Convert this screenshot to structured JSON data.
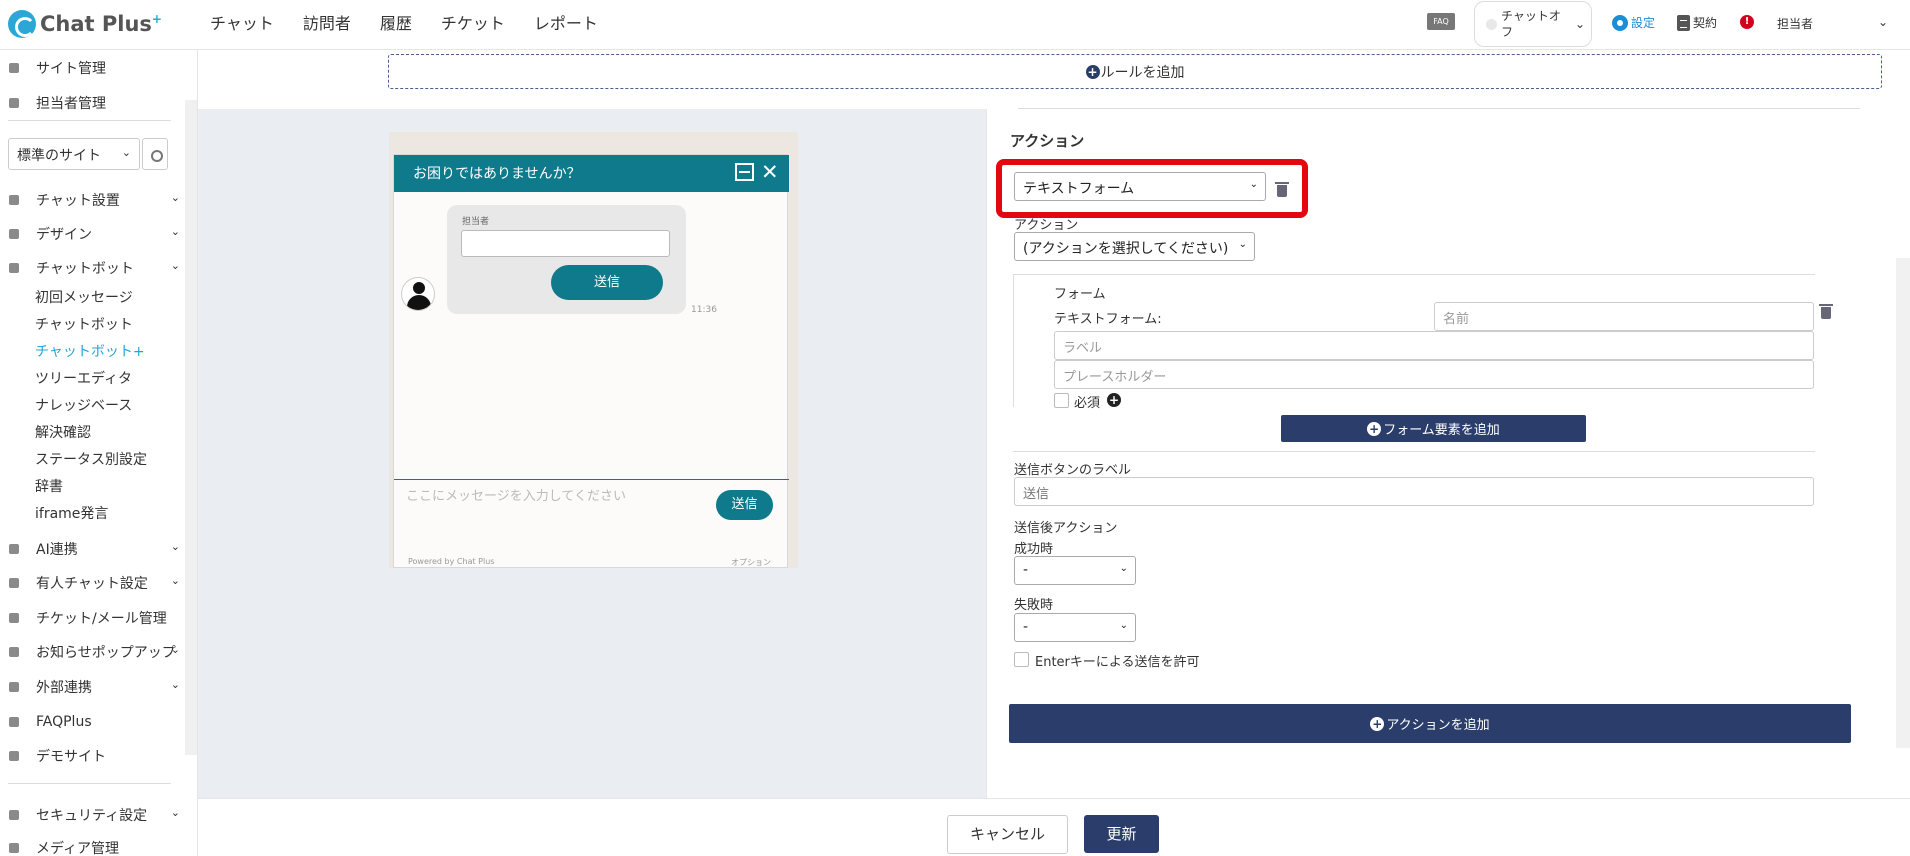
{
  "header": {
    "logo_text": "Chat Plus",
    "logo_plus": "+",
    "nav": [
      "チャット",
      "訪問者",
      "履歴",
      "チケット",
      "レポート"
    ],
    "faq_badge": "FAQ",
    "status_label": "チャットオフ",
    "settings_label": "設定",
    "contract_label": "契約",
    "alert_mark": "!",
    "user_label": "担当者"
  },
  "sidebar": {
    "top_items": [
      "サイト管理",
      "担当者管理"
    ],
    "site_select_value": "標準のサイト",
    "sections": [
      {
        "label": "チャット設置"
      },
      {
        "label": "デザイン"
      },
      {
        "label": "チャットボット"
      }
    ],
    "chatbot_sub": [
      "初回メッセージ",
      "チャットボット",
      "チャットボット+",
      "ツリーエディタ",
      "ナレッジベース",
      "解決確認",
      "ステータス別設定",
      "辞書",
      "iframe発言"
    ],
    "active_sub": "チャットボット+",
    "lower_items": [
      "AI連携",
      "有人チャット設定",
      "チケット/メール管理",
      "お知らせポップアップ",
      "外部連携",
      "FAQPlus",
      "デモサイト"
    ],
    "bottom_items": [
      "セキュリティ設定",
      "メディア管理"
    ]
  },
  "main": {
    "add_rule_label": "ルールを追加",
    "preview": {
      "header_title": "お困りではありませんか？",
      "bubble_label": "担当者",
      "bubble_button": "送信",
      "time": "11:36",
      "input_placeholder": "ここにメッセージを入力してください",
      "send_button": "送信",
      "powered_by": "Powered by Chat Plus",
      "option_label": "オプション"
    },
    "action": {
      "heading": "アクション",
      "type_value": "テキストフォーム",
      "sub_label": "アクション",
      "sub_select_value": "(アクションを選択してください)",
      "form_label": "フォーム",
      "textform_label": "テキストフォーム:",
      "name_placeholder": "名前",
      "label_placeholder": "ラベル",
      "placeholder_placeholder": "プレースホルダー",
      "required_label": "必須",
      "add_form_element": "フォーム要素を追加",
      "send_button_label_title": "送信ボタンのラベル",
      "send_button_label_value": "送信",
      "after_send_title": "送信後アクション",
      "success_label": "成功時",
      "success_value": "-",
      "failure_label": "失敗時",
      "failure_value": "-",
      "enter_key_label": "Enterキーによる送信を許可",
      "add_action": "アクションを追加"
    },
    "footer": {
      "cancel": "キャンセル",
      "update": "更新"
    }
  },
  "colors": {
    "navy": "#2b3e6b",
    "teal": "#0e7a8c",
    "highlight_red": "#e4070f",
    "active_link": "#23a3d9"
  }
}
